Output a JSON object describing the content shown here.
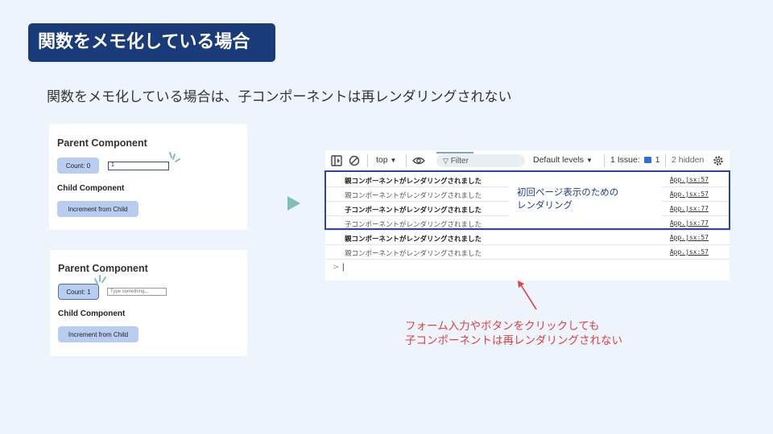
{
  "slide": {
    "title": "関数をメモ化している場合",
    "subtitle": "関数をメモ化している場合は、子コンポーネントは再レンダリングされない"
  },
  "card1": {
    "heading": "Parent Component",
    "count_button": "Count: 0",
    "input_value": "1",
    "child_heading": "Child Component",
    "child_button": "Increment from Child"
  },
  "card2": {
    "heading": "Parent Component",
    "count_button": "Count: 1",
    "input_placeholder": "Type something...",
    "child_heading": "Child Component",
    "child_button": "Increment from Child"
  },
  "console": {
    "toolbar": {
      "context": "top",
      "filter_placeholder": "Filter",
      "levels": "Default levels",
      "issues": "1 Issue:",
      "issue_count": "1",
      "hidden": "2 hidden"
    },
    "logs": [
      {
        "message": "親コンポーネントがレンダリングされました",
        "source": "App.jsx:57"
      },
      {
        "message": "親コンポーネントがレンダリングされました",
        "source": "App.jsx:57"
      },
      {
        "message": "子コンポーネントがレンダリングされました",
        "source": "App.jsx:77"
      },
      {
        "message": "子コンポーネントがレンダリングされました",
        "source": "App.jsx:77"
      },
      {
        "message": "親コンポーネントがレンダリングされました",
        "source": "App.jsx:57"
      },
      {
        "message": "親コンポーネントがレンダリングされました",
        "source": "App.jsx:57"
      }
    ],
    "prompt": ">"
  },
  "annotations": {
    "initial_render_note_line1": "初回ページ表示のための",
    "initial_render_note_line2": "レンダリング",
    "red_note_line1": "フォーム入力やボタンをクリックしても",
    "red_note_line2": "子コンポーネントは再レンダリングされない"
  },
  "colors": {
    "title_bg": "#1a3b7a",
    "highlight_border": "#2a44a8",
    "note_text": "#1f3f99",
    "red_annotation": "#e04040",
    "button_bg": "#b9cdf0",
    "teal_arrow": "#7fbfb6"
  },
  "icons": [
    "sidebar-toggle-icon",
    "clear-console-icon",
    "chevron-down-icon",
    "eye-icon",
    "filter-icon",
    "issue-message-icon",
    "gear-icon",
    "sparkle-icon",
    "play-arrow-icon",
    "red-up-arrow-icon"
  ]
}
